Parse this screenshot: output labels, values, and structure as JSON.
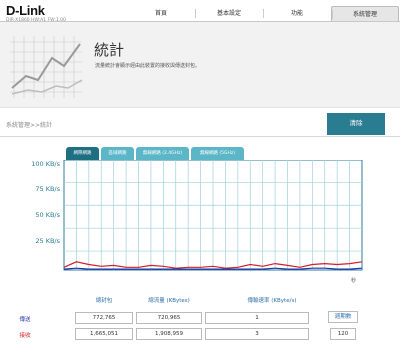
{
  "brand": {
    "logo": "D-Link",
    "model": "DIR-X1860 HW:A1 FW:1.00"
  },
  "nav": {
    "items": [
      {
        "label": "首頁"
      },
      {
        "label": "基本設定"
      },
      {
        "label": "功能"
      },
      {
        "label": "系統管理",
        "active": true
      }
    ]
  },
  "header": {
    "title": "統計",
    "description": "流量統計會顯示經由此裝置的接收與傳送封包。"
  },
  "breadcrumb": "系統管理>>統計",
  "clear_button": "清除",
  "tabs": [
    {
      "label": "網際網路",
      "active": true
    },
    {
      "label": "區域網路"
    },
    {
      "label": "無線網路 (2.4GHz)"
    },
    {
      "label": "無線網路 (5GHz)"
    }
  ],
  "chart_data": {
    "type": "line",
    "y_ticks": [
      "100 KB/s",
      "75 KB/s",
      "50 KB/s",
      "25 KB/s"
    ],
    "x_unit": "秒",
    "ylim": [
      0,
      120
    ],
    "grid": true,
    "series": [
      {
        "color": "#d0202a",
        "values": [
          3,
          9,
          6,
          4,
          5,
          3,
          3,
          5,
          4,
          2,
          3,
          3,
          4,
          2,
          3,
          6,
          4,
          7,
          5,
          3,
          6,
          7,
          6,
          7,
          9
        ]
      },
      {
        "color": "#2233aa",
        "values": [
          1,
          2,
          1,
          1,
          1,
          1,
          1,
          1,
          1,
          1,
          1,
          1,
          1,
          1,
          1,
          1,
          1,
          2,
          1,
          1,
          2,
          2,
          1,
          1,
          2
        ]
      }
    ],
    "axis_color": "#2b7d99"
  },
  "stats": {
    "headers": [
      "總封包",
      "總流量 (KBytes)",
      "傳輸速率 (KByte/s)",
      "週期數"
    ],
    "rows": [
      {
        "label": "傳送",
        "label_color": "#2233aa",
        "packets": "772,765",
        "traffic": "720,965",
        "rate": "1"
      },
      {
        "label": "接收",
        "label_color": "#d0202a",
        "packets": "1,665,051",
        "traffic": "1,908,959",
        "rate": "3"
      }
    ],
    "interval": "120"
  }
}
